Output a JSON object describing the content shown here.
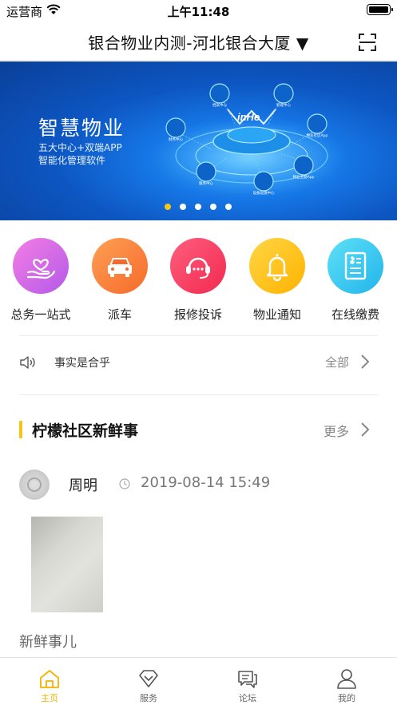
{
  "status_bar": {
    "carrier": "运营商",
    "time": "上午11:48"
  },
  "nav": {
    "title": "银合物业内测-河北银合大厦 ▼"
  },
  "banner": {
    "title": "智慧物业",
    "subtitle_line1": "五大中心+双端APP",
    "subtitle_line2": "智能化管理软件",
    "logo_text": "inHe",
    "nodes": [
      "档案中心",
      "智能中心",
      "物业社区App",
      "物业主题App",
      "设备设施中心",
      "财务中心",
      "服务中心"
    ],
    "slide_count": 5,
    "active_slide": 1
  },
  "services": [
    {
      "label": "总务一站式",
      "icon": "heart-hand-icon",
      "color_from": "#f47ee4",
      "color_to": "#b459e8"
    },
    {
      "label": "派车",
      "icon": "car-icon",
      "color_from": "#ffa055",
      "color_to": "#f56a2a"
    },
    {
      "label": "报修投诉",
      "icon": "headset-icon",
      "color_from": "#ff5f7e",
      "color_to": "#f2294f"
    },
    {
      "label": "物业通知",
      "icon": "bell-icon",
      "color_from": "#ffd645",
      "color_to": "#ffb300"
    },
    {
      "label": "在线缴费",
      "icon": "bill-icon",
      "color_from": "#5ee1f7",
      "color_to": "#22b4ea"
    }
  ],
  "notice": {
    "text": "事实是合乎",
    "all_label": "全部"
  },
  "community": {
    "title": "柠檬社区新鲜事",
    "more_label": "更多"
  },
  "post": {
    "author": "周明",
    "time": "2019-08-14 15:49",
    "text": "新鲜事儿"
  },
  "tabs": [
    {
      "label": "主页",
      "icon": "home-icon",
      "active": true
    },
    {
      "label": "服务",
      "icon": "diamond-icon",
      "active": false
    },
    {
      "label": "论坛",
      "icon": "chat-icon",
      "active": false
    },
    {
      "label": "我的",
      "icon": "person-icon",
      "active": false
    }
  ],
  "colors": {
    "accent": "#f5c518",
    "tab_active": "#f0b400",
    "banner_blue": "#0d56c2"
  }
}
